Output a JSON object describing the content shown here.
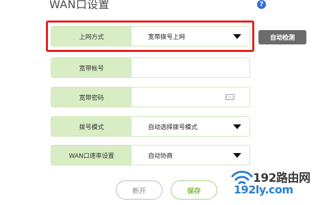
{
  "page": {
    "title": "WAN口设置"
  },
  "form": {
    "connection_type": {
      "label": "上网方式",
      "value": "宽带拨号上网"
    },
    "broadband_account": {
      "label": "宽带帐号",
      "value": ""
    },
    "broadband_password": {
      "label": "宽带密码",
      "value": ""
    },
    "dial_mode": {
      "label": "拨号模式",
      "value": "自动选择拨号模式"
    },
    "wan_speed": {
      "label": "WAN口速率设置",
      "value": "自动协商"
    }
  },
  "buttons": {
    "auto_detect": "自动检测",
    "disconnect": "断开",
    "save": "保存"
  },
  "icons": {
    "help": "help-icon",
    "dropdown": "chevron-down-icon",
    "keyboard": "keyboard-icon"
  },
  "watermark": {
    "brand": "192路由网",
    "url": "192ly.com"
  },
  "colors": {
    "label_bg": "#d8edc4",
    "highlight": "#e0211e",
    "accent_green": "#7bbf3a",
    "detect_button": "#6b6b6b",
    "help_icon": "#2f6fd6",
    "watermark_blue": "#2a7fd0"
  }
}
